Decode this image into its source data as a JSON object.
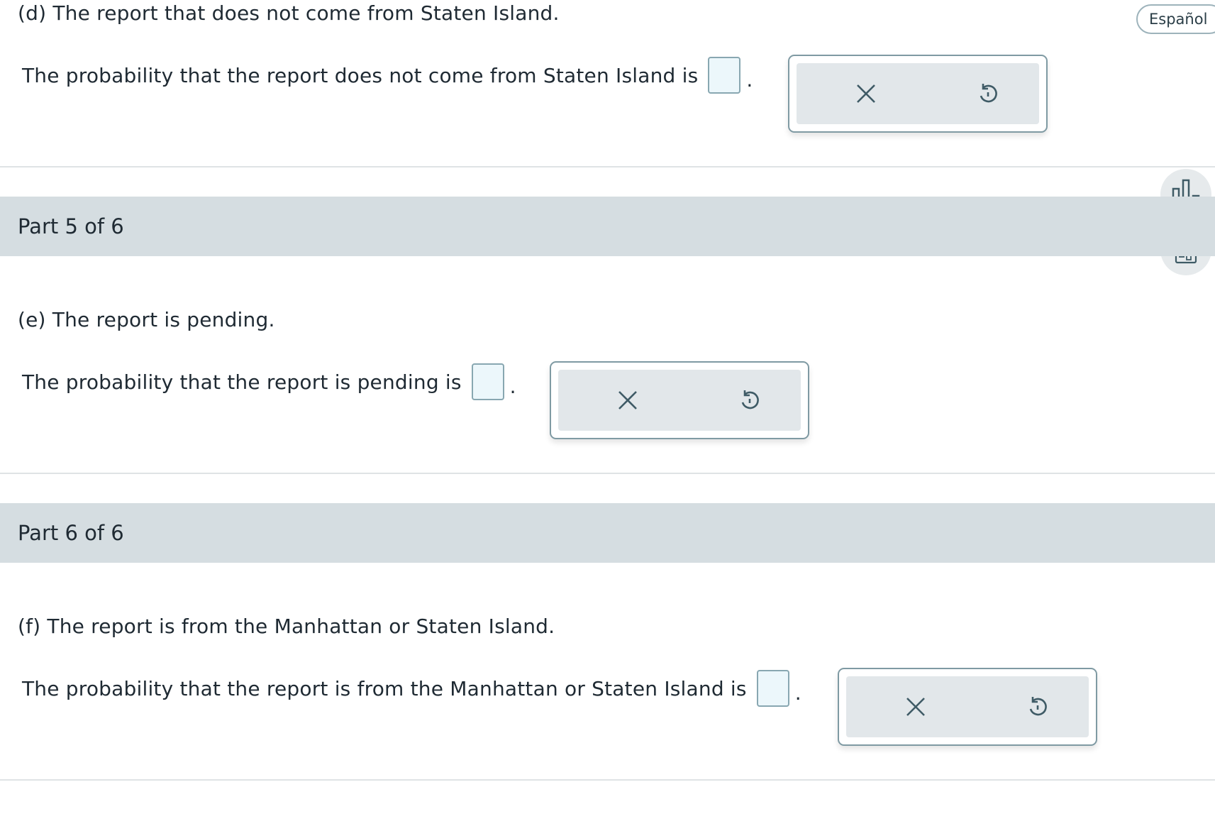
{
  "language_button": {
    "label": "Español"
  },
  "questions": [
    {
      "prompt": "(d) The report that does not come from Staten Island.",
      "answer_text": "The probability that the report does not come from Staten Island is",
      "suffix": "."
    },
    {
      "part_label": "Part 5 of 6",
      "prompt": "(e) The report is pending.",
      "answer_text": "The probability that the report is pending is",
      "suffix": "."
    },
    {
      "part_label": "Part 6 of 6",
      "prompt": "(f) The report is from the Manhattan or Staten Island.",
      "answer_text": "The probability that the report is from the Manhattan or Staten Island is",
      "suffix": "."
    }
  ],
  "icons": {
    "clear": "close-icon",
    "undo": "undo-icon",
    "data": "bar-chart-icon",
    "calculator": "calculator-icon"
  },
  "colors": {
    "part_bar": "#d5dde1",
    "answer_box_fill": "#ecf7fb",
    "answer_box_border": "#88a7b1",
    "icon": "#3f5b66"
  }
}
